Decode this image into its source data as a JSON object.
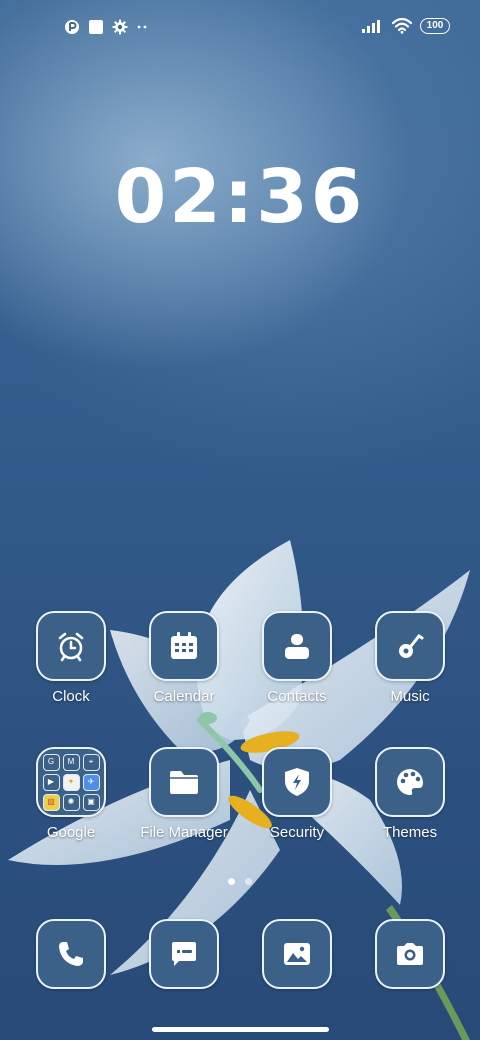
{
  "status_bar": {
    "left_icons": [
      "notification-app-icon",
      "notification-square-icon",
      "settings-gear-icon",
      "more-notifications-icon"
    ],
    "signal": "4 bars",
    "wifi": "connected",
    "battery_label": "100"
  },
  "clock": {
    "time": "02:36"
  },
  "apps": [
    {
      "label": "Clock",
      "icon": "alarm-clock-icon"
    },
    {
      "label": "Calendar",
      "icon": "calendar-icon"
    },
    {
      "label": "Contacts",
      "icon": "contacts-icon"
    },
    {
      "label": "Music",
      "icon": "music-note-icon"
    },
    {
      "label": "Google",
      "icon": "folder-icon"
    },
    {
      "label": "File Manager",
      "icon": "folder-icon"
    },
    {
      "label": "Security",
      "icon": "shield-bolt-icon"
    },
    {
      "label": "Themes",
      "icon": "palette-icon"
    }
  ],
  "google_folder": [
    "G",
    "M",
    "⌖",
    "▶",
    "✦",
    "✈",
    "▧",
    "✺",
    "▣"
  ],
  "dock": [
    {
      "label": "Phone",
      "icon": "phone-icon"
    },
    {
      "label": "Messages",
      "icon": "message-icon"
    },
    {
      "label": "Gallery",
      "icon": "image-icon"
    },
    {
      "label": "Camera",
      "icon": "camera-icon"
    }
  ],
  "page_indicator": {
    "pages": 2,
    "current": 1
  },
  "colors": {
    "tile_bg": "#3c6189",
    "tile_border": "#e9f3fb",
    "wallpaper": "#2f5685"
  }
}
